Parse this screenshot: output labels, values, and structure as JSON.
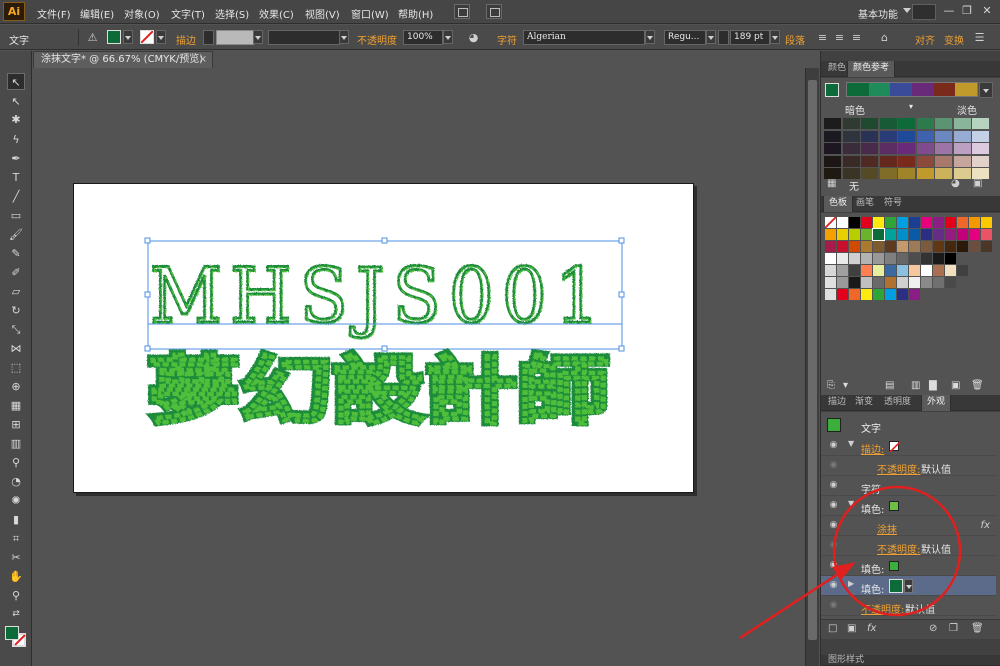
{
  "app": {
    "logo": "Ai",
    "workspace": "基本功能"
  },
  "menu": [
    "文件(F)",
    "编辑(E)",
    "对象(O)",
    "文字(T)",
    "选择(S)",
    "效果(C)",
    "视图(V)",
    "窗口(W)",
    "帮助(H)"
  ],
  "window_controls": {
    "minimize": "—",
    "restore": "❐",
    "close": "✕"
  },
  "control_bar": {
    "object_type": "文字",
    "stroke_label": "描边",
    "opacity_label": "不透明度",
    "opacity_value": "100%",
    "char_label": "字符",
    "font_family": "Algerian",
    "font_style": "Regu...",
    "font_size": "189 pt",
    "paragraph_label": "段落",
    "align_label": "对齐",
    "transform_label": "变换",
    "fill_color": "#0d6b3a",
    "stroke_color": "none"
  },
  "document_tab": {
    "title": "涂抹文字* @ 66.67% (CMYK/预览)",
    "close": "×"
  },
  "artwork": {
    "line1": "MHSJS001",
    "line2": "夢幻設計師",
    "scribble_colors": [
      "#1f8b3a",
      "#4fbf3a",
      "#0d6b3a"
    ]
  },
  "color_guide_panel": {
    "tabs": [
      "颜色",
      "颜色参考"
    ],
    "active_tab": "颜色参考",
    "base_color": "#0d6b3a",
    "harmony": [
      "#0d6b3a",
      "#1f8b5a",
      "#3a4b9a",
      "#6a2a7a",
      "#7a2a1a",
      "#c09a2a"
    ],
    "shade_label": "暗色",
    "tint_label": "淡色",
    "none_label": "无"
  },
  "swatches_panel": {
    "tabs": [
      "色板",
      "画笔",
      "符号"
    ],
    "active_tab": "色板"
  },
  "appearance_panel": {
    "tabs": [
      "描边",
      "渐变",
      "透明度",
      "外观"
    ],
    "active_tab": "外观",
    "title": "文字",
    "rows": [
      {
        "label": "描边:",
        "orange": true,
        "swatch": "none",
        "indent": 40
      },
      {
        "label": "不透明度: ",
        "orange": true,
        "value": "默认值",
        "indent": 56
      },
      {
        "label": "字符",
        "orange": false,
        "indent": 40
      },
      {
        "label": "填色:",
        "orange": false,
        "swatch": "#6cc04a",
        "indent": 40
      },
      {
        "label": "涂抹",
        "orange": true,
        "fx": true,
        "indent": 56
      },
      {
        "label": "不透明度: ",
        "orange": true,
        "value": "默认值",
        "indent": 56
      },
      {
        "label": "填色:",
        "orange": false,
        "swatch": "#3cae3c",
        "indent": 40
      },
      {
        "label": "填色:",
        "orange": false,
        "swatch": "#0d6b3a",
        "indent": 40
      },
      {
        "label": "不透明度: ",
        "orange": true,
        "value": "默认值",
        "indent": 40
      }
    ],
    "fx_label": "fx"
  },
  "bottom_panel_tab": "图形样式"
}
